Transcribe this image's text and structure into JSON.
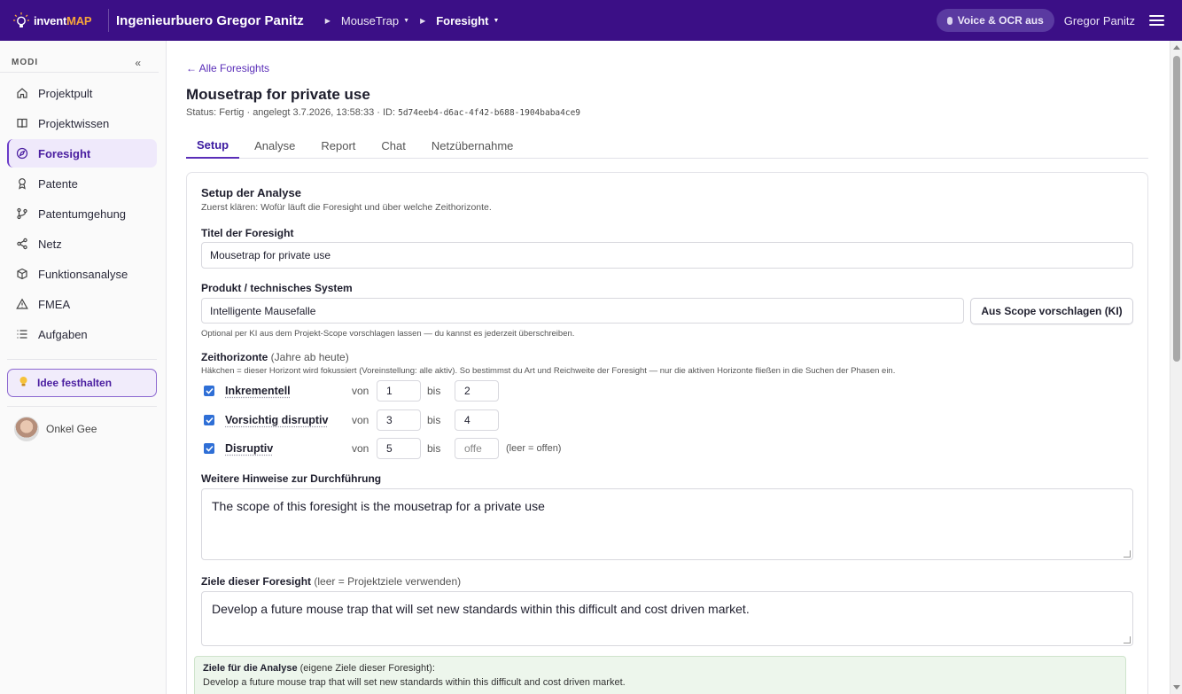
{
  "app": {
    "brand_a": "invent",
    "brand_b": "MAP",
    "workspace": "Ingenieurbuero Gregor Panitz",
    "breadcrumb": [
      {
        "label": "MouseTrap"
      },
      {
        "label": "Foresight"
      }
    ],
    "voice_toggle": "Voice & OCR aus",
    "user": "Gregor Panitz"
  },
  "sidebar": {
    "section": "MODI",
    "collapse": "«",
    "items": [
      {
        "label": "Projektpult",
        "icon": "home-icon"
      },
      {
        "label": "Projektwissen",
        "icon": "book-icon"
      },
      {
        "label": "Foresight",
        "icon": "compass-icon",
        "active": true
      },
      {
        "label": "Patente",
        "icon": "award-icon"
      },
      {
        "label": "Patentumgehung",
        "icon": "git-branch-icon"
      },
      {
        "label": "Netz",
        "icon": "share-icon"
      },
      {
        "label": "Funktionsanalyse",
        "icon": "cube-icon"
      },
      {
        "label": "FMEA",
        "icon": "warning-icon"
      },
      {
        "label": "Aufgaben",
        "icon": "list-icon"
      }
    ],
    "idea_button": "Idee festhalten",
    "profile_name": "Onkel Gee"
  },
  "page": {
    "back_link": "← Alle Foresights",
    "title": "Mousetrap for private use",
    "meta_prefix": "Status: Fertig · angelegt 3.7.2026, 13:58:33 · ID:",
    "meta_id": "5d74eeb4-d6ac-4f42-b688-1904baba4ce9",
    "tabs": [
      "Setup",
      "Analyse",
      "Report",
      "Chat",
      "Netzübernahme"
    ],
    "active_tab": "Setup"
  },
  "setup": {
    "heading": "Setup der Analyse",
    "subheading": "Zuerst klären: Wofür läuft die Foresight und über welche Zeithorizonte.",
    "title_label": "Titel der Foresight",
    "title_value": "Mousetrap for private use",
    "product_label": "Produkt / technisches System",
    "product_value": "Intelligente Mausefalle",
    "suggest_button": "Aus Scope vorschlagen (KI)",
    "product_hint": "Optional per KI aus dem Projekt-Scope vorschlagen lassen — du kannst es jederzeit überschreiben.",
    "horizons_label": "Zeithorizonte",
    "horizons_label_light": "(Jahre ab heute)",
    "horizons_hint": "Häkchen = dieser Horizont wird fokussiert (Voreinstellung: alle aktiv). So bestimmst du Art und Reichweite der Foresight — nur die aktiven Horizonte fließen in die Suchen der Phasen ein.",
    "von": "von",
    "bis": "bis",
    "horizons": [
      {
        "name": "Inkrementell",
        "checked": true,
        "from": "1",
        "to": "2",
        "to_placeholder": ""
      },
      {
        "name": "Vorsichtig disruptiv",
        "checked": true,
        "from": "3",
        "to": "4",
        "to_placeholder": ""
      },
      {
        "name": "Disruptiv",
        "checked": true,
        "from": "5",
        "to": "",
        "to_placeholder": "offe"
      }
    ],
    "open_note": "(leer = offen)",
    "notes_label": "Weitere Hinweise zur Durchführung",
    "notes_value": "The scope of this foresight is the mousetrap for a private use",
    "goals_label": "Ziele dieser Foresight",
    "goals_label_light": "(leer = Projektziele verwenden)",
    "goals_value": "Develop a future mouse trap that will set new standards within this difficult and cost driven market.",
    "analysis_goals_label": "Ziele für die Analyse",
    "analysis_goals_light": "(eigene Ziele dieser Foresight):",
    "analysis_goals_text": "Develop a future mouse trap that will set new standards within this difficult and cost driven market."
  },
  "colors": {
    "topbar": "#3b0f86",
    "accent": "#5a2eb8",
    "brand_orange": "#f6a53a",
    "checkbox": "#2f6fd6"
  }
}
